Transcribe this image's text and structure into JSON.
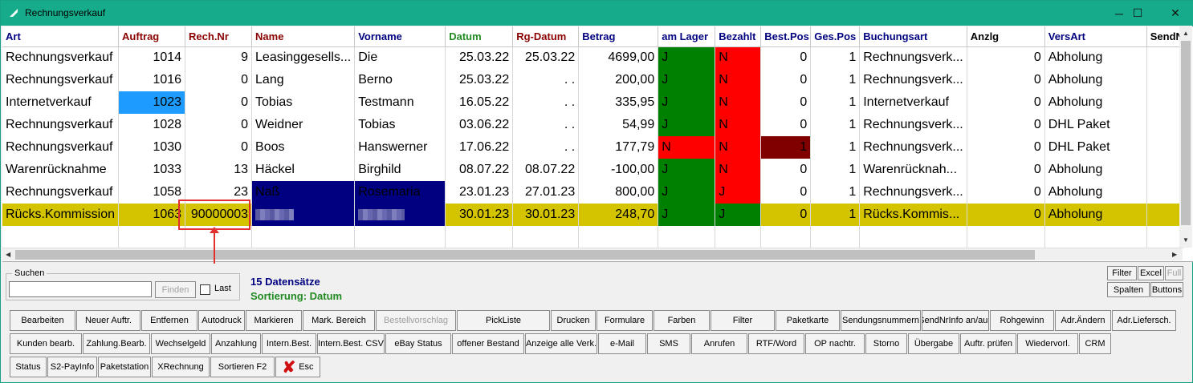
{
  "window": {
    "title": "Rechnungsverkauf",
    "minimize": "─",
    "maximize": "☐",
    "close": "✕"
  },
  "columns": [
    "Art",
    "Auftrag",
    "Rech.Nr",
    "Name",
    "Vorname",
    "Datum",
    "Rg-Datum",
    "Betrag",
    "am Lager",
    "Bezahlt",
    "Best.Pos",
    "Ges.Pos",
    "Buchungsart",
    "Anzlg",
    "VersArt",
    "SendN"
  ],
  "rows": [
    [
      "Rechnungsverkauf",
      "1014",
      "9",
      "Leasinggesells...",
      "Die",
      "25.03.22",
      "25.03.22",
      "4699,00",
      "J",
      "N",
      "0",
      "1",
      "Rechnungsverk...",
      "0",
      "Abholung",
      ""
    ],
    [
      "Rechnungsverkauf",
      "1016",
      "0",
      "Lang",
      "Berno",
      "25.03.22",
      ". .",
      "200,00",
      "J",
      "N",
      "0",
      "1",
      "Rechnungsverk...",
      "0",
      "Abholung",
      ""
    ],
    [
      "Internetverkauf",
      "1023",
      "0",
      "Tobias",
      "Testmann",
      "16.05.22",
      ". .",
      "335,95",
      "J",
      "N",
      "0",
      "1",
      "Internetverkauf",
      "0",
      "Abholung",
      ""
    ],
    [
      "Rechnungsverkauf",
      "1028",
      "0",
      "Weidner",
      "Tobias",
      "03.06.22",
      ". .",
      "54,99",
      "J",
      "N",
      "0",
      "1",
      "Rechnungsverk...",
      "0",
      "DHL Paket",
      ""
    ],
    [
      "Rechnungsverkauf",
      "1030",
      "0",
      "Boos",
      "Hanswerner",
      "17.06.22",
      ". .",
      "177,79",
      "N",
      "N",
      "1",
      "1",
      "Rechnungsverk...",
      "0",
      "DHL Paket",
      ""
    ],
    [
      "Warenrücknahme",
      "1033",
      "13",
      "Häckel",
      "Birghild",
      "08.07.22",
      "08.07.22",
      "-100,00",
      "J",
      "N",
      "0",
      "1",
      "Warenrücknah...",
      "0",
      "Abholung",
      ""
    ],
    [
      "Rechnungsverkauf",
      "1058",
      "23",
      "Naß",
      "Rosemaria",
      "23.01.23",
      "27.01.23",
      "800,00",
      "J",
      "J",
      "0",
      "1",
      "Rechnungsverk...",
      "0",
      "Abholung",
      ""
    ],
    [
      "Rücks.Kommission",
      "1063",
      "90000003",
      "",
      "",
      "30.01.23",
      "30.01.23",
      "248,70",
      "J",
      "J",
      "0",
      "1",
      "Rücks.Kommis...",
      "0",
      "Abholung",
      ""
    ]
  ],
  "search": {
    "legend": "Suchen",
    "value": "",
    "find_button": "Finden",
    "last_label": "Last"
  },
  "info": {
    "count": "15 Datensätze",
    "sort": "Sortierung: Datum"
  },
  "right_buttons": [
    "Filter",
    "Excel",
    "Full",
    "Spalten",
    "Buttons"
  ],
  "toolbar_row1": [
    "Bearbeiten",
    "Neuer Auftr.",
    "Entfernen",
    "Autodruck",
    "Markieren",
    "Mark. Bereich",
    "Bestellvorschlag",
    "PickListe",
    "Drucken",
    "Formulare",
    "Farben",
    "Filter",
    "Paketkarte",
    "Sendungsnummern",
    "SendNrInfo an/aus",
    "Rohgewinn",
    "Adr.Ändern",
    "Adr.Liefersch."
  ],
  "toolbar_row2": [
    "Kunden bearb.",
    "Zahlung.Bearb.",
    "Wechselgeld",
    "Anzahlung",
    "Intern.Best.",
    "Intern.Best. CSV",
    "eBay Status",
    "offener Bestand",
    "Anzeige alle Verk.",
    "e-Mail",
    "SMS",
    "Anrufen",
    "RTF/Word",
    "OP nachtr.",
    "Storno",
    "Übergabe",
    "Auftr. prüfen",
    "Wiedervorl.",
    "CRM"
  ],
  "toolbar_row3": [
    "Status",
    "S2-PayInfo",
    "Paketstation",
    "XRechnung",
    "Sortieren F2",
    "Esc"
  ],
  "colors": {
    "titlebar": "#16ab8a",
    "green_cell": "#008000",
    "red_cell": "#ff0000",
    "selected_row": "#d4c400",
    "navy_cell": "#000080"
  }
}
